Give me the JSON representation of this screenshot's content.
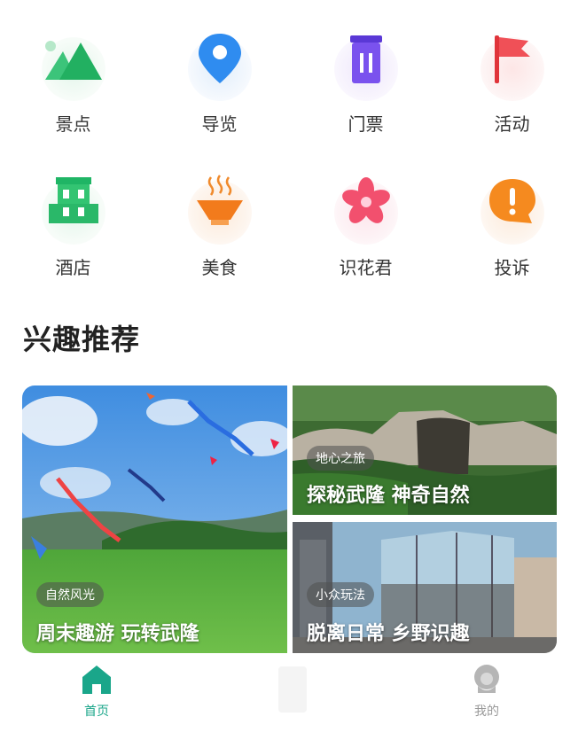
{
  "categories": [
    {
      "label": "景点",
      "icon": "mountain-icon"
    },
    {
      "label": "导览",
      "icon": "map-pin-icon"
    },
    {
      "label": "门票",
      "icon": "ticket-icon"
    },
    {
      "label": "活动",
      "icon": "flag-icon"
    },
    {
      "label": "酒店",
      "icon": "hotel-icon"
    },
    {
      "label": "美食",
      "icon": "food-bowl-icon"
    },
    {
      "label": "识花君",
      "icon": "flower-icon"
    },
    {
      "label": "投诉",
      "icon": "complaint-icon"
    }
  ],
  "section": {
    "title": "兴趣推荐"
  },
  "cards": [
    {
      "tag": "自然风光",
      "caption": "周末趣游 玩转武隆"
    },
    {
      "tag": "地心之旅",
      "caption": "探秘武隆 神奇自然"
    },
    {
      "tag": "小众玩法",
      "caption": "脱离日常 乡野识趣"
    }
  ],
  "tabbar": {
    "home_label": "首页",
    "mine_label": "我的",
    "active_color": "#1aa68a",
    "inactive_color": "#999999"
  }
}
